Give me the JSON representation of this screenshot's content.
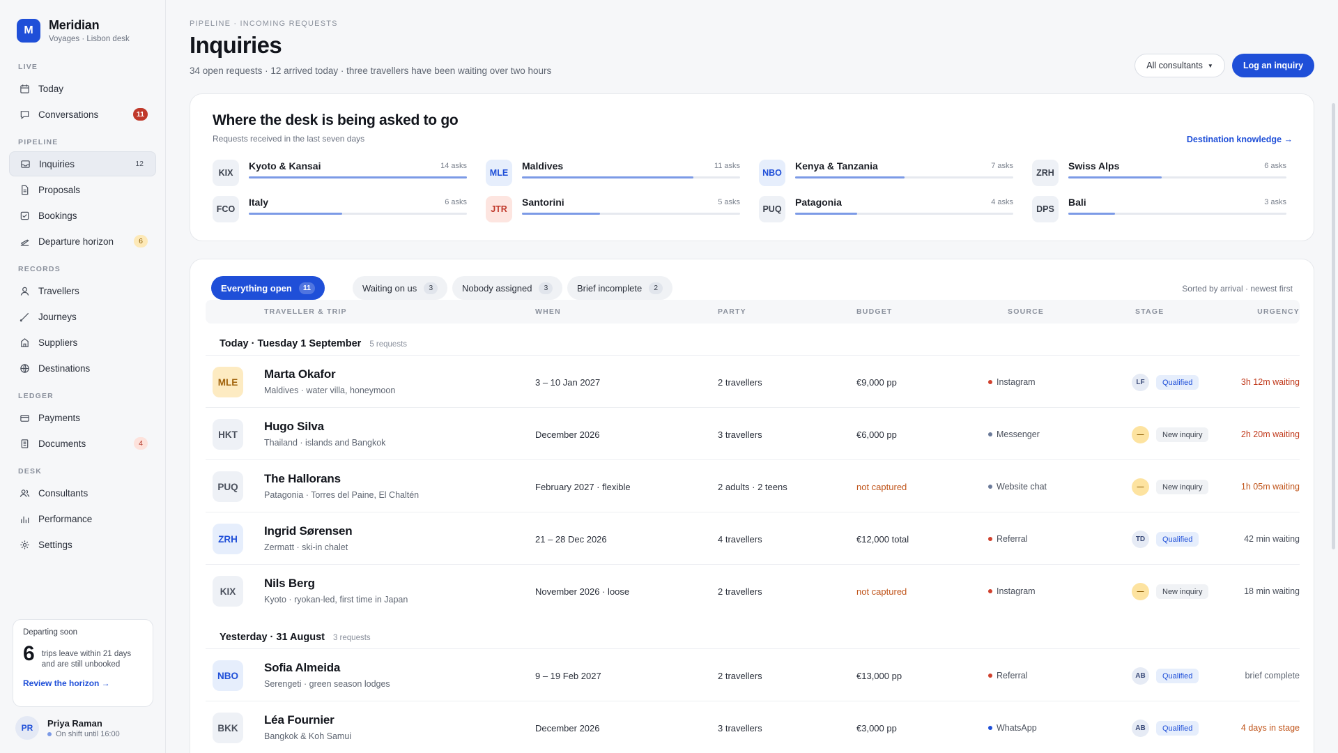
{
  "brand": {
    "initial": "M",
    "name": "Meridian",
    "sub": "Voyages · Lisbon desk"
  },
  "nav": {
    "sections": {
      "live": "LIVE",
      "pipeline": "PIPELINE",
      "records": "RECORDS",
      "ledger": "LEDGER",
      "desk": "DESK"
    },
    "today": "Today",
    "conversations": {
      "label": "Conversations",
      "badge": "11"
    },
    "inquiries": {
      "label": "Inquiries",
      "badge": "12"
    },
    "proposals": "Proposals",
    "bookings": "Bookings",
    "departure": {
      "label": "Departure horizon",
      "badge": "6"
    },
    "travellers": "Travellers",
    "journeys": "Journeys",
    "suppliers": "Suppliers",
    "destinations": "Destinations",
    "payments": "Payments",
    "documents": {
      "label": "Documents",
      "badge": "4"
    },
    "consultants": "Consultants",
    "performance": "Performance",
    "settings": "Settings"
  },
  "departing": {
    "label": "Departing soon",
    "count": "6",
    "text_1": "trips leave within 21 days",
    "text_2": "and are still unbooked",
    "link": "Review the horizon →"
  },
  "user": {
    "initials": "PR",
    "name": "Priya Raman",
    "shift": "On shift until 16:00"
  },
  "header": {
    "crumb": "PIPELINE · INCOMING REQUESTS",
    "title": "Inquiries",
    "subtitle": "34 open requests · 12 arrived today · three travellers have been waiting over two hours",
    "consultants_select": "All consultants",
    "primary": "Log an inquiry"
  },
  "destinations_card": {
    "title": "Where the desk is being asked to go",
    "sub": "Requests received in the last seven days",
    "link": "Destination knowledge →",
    "items": [
      {
        "code": "KIX",
        "name": "Kyoto & Kansai",
        "count": "14 asks",
        "value": 14
      },
      {
        "code": "MLE",
        "name": "Maldives",
        "count": "11 asks",
        "value": 11
      },
      {
        "code": "NBO",
        "name": "Kenya & Tanzania",
        "count": "7 asks",
        "value": 7
      },
      {
        "code": "ZRH",
        "name": "Swiss Alps",
        "count": "6 asks",
        "value": 6
      },
      {
        "code": "FCO",
        "name": "Italy",
        "count": "6 asks",
        "value": 6
      },
      {
        "code": "JTR",
        "name": "Santorini",
        "count": "5 asks",
        "value": 5
      },
      {
        "code": "PUQ",
        "name": "Patagonia",
        "count": "4 asks",
        "value": 4
      },
      {
        "code": "DPS",
        "name": "Bali",
        "count": "3 asks",
        "value": 3
      }
    ]
  },
  "tabs": [
    {
      "label": "Everything open",
      "count": "11"
    },
    {
      "label": "Waiting on us",
      "count": "3"
    },
    {
      "label": "Nobody assigned",
      "count": "3"
    },
    {
      "label": "Brief incomplete",
      "count": "2"
    }
  ],
  "sort_note": "Sorted by arrival · newest first",
  "columns": [
    "TRAVELLER & TRIP",
    "WHEN",
    "PARTY",
    "BUDGET",
    "SOURCE",
    "STAGE",
    "URGENCY"
  ],
  "groups": [
    {
      "title": "Today · Tuesday 1 September",
      "count": "5 requests"
    },
    {
      "title": "Yesterday · 31 August",
      "count": "3 requests"
    }
  ],
  "rows": [
    {
      "code": "MLE",
      "name": "Marta Okafor",
      "trip": "Maldives · water villa, honeymoon",
      "when": "3 – 10 Jan 2027",
      "party": "2 travellers",
      "budget": "€9,000 pp",
      "source": "Instagram",
      "assignee": "LF",
      "stage": "Qualified",
      "urgency": "3h 12m waiting"
    },
    {
      "code": "HKT",
      "name": "Hugo Silva",
      "trip": "Thailand · islands and Bangkok",
      "when": "December 2026",
      "party": "3 travellers",
      "budget": "€6,000 pp",
      "source": "Messenger",
      "assignee": "—",
      "stage": "New inquiry",
      "urgency": "2h 20m waiting"
    },
    {
      "code": "PUQ",
      "name": "The Hallorans",
      "trip": "Patagonia · Torres del Paine, El Chaltén",
      "when": "February 2027 · flexible",
      "party": "2 adults · 2 teens",
      "budget": "not captured",
      "source": "Website chat",
      "assignee": "—",
      "stage": "New inquiry",
      "urgency": "1h 05m waiting"
    },
    {
      "code": "ZRH",
      "name": "Ingrid Sørensen",
      "trip": "Zermatt · ski-in chalet",
      "when": "21 – 28 Dec 2026",
      "party": "4 travellers",
      "budget": "€12,000 total",
      "source": "Referral",
      "assignee": "TD",
      "stage": "Qualified",
      "urgency": "42 min waiting"
    },
    {
      "code": "KIX",
      "name": "Nils Berg",
      "trip": "Kyoto · ryokan-led, first time in Japan",
      "when": "November 2026 · loose",
      "party": "2 travellers",
      "budget": "not captured",
      "source": "Instagram",
      "assignee": "—",
      "stage": "New inquiry",
      "urgency": "18 min waiting"
    },
    {
      "code": "NBO",
      "name": "Sofia Almeida",
      "trip": "Serengeti · green season lodges",
      "when": "9 – 19 Feb 2027",
      "party": "2 travellers",
      "budget": "€13,000 pp",
      "source": "Referral",
      "assignee": "AB",
      "stage": "Qualified",
      "urgency": "brief complete"
    },
    {
      "code": "BKK",
      "name": "Léa Fournier",
      "trip": "Bangkok & Koh Samui",
      "when": "December 2026",
      "party": "3 travellers",
      "budget": "€3,000 pp",
      "source": "WhatsApp",
      "assignee": "AB",
      "stage": "Qualified",
      "urgency": "4 days in stage"
    }
  ],
  "colors": {
    "accent": "#1f4fd8",
    "warn": "#c0541a",
    "danger": "#c0392b"
  },
  "icons": [
    "calendar-icon",
    "chat-icon",
    "inbox-icon",
    "document-icon",
    "check-square-icon",
    "plane-icon",
    "person-icon",
    "route-icon",
    "building-icon",
    "globe-icon",
    "wallet-icon",
    "file-icon",
    "people-icon",
    "bar-chart-icon",
    "gear-icon"
  ]
}
